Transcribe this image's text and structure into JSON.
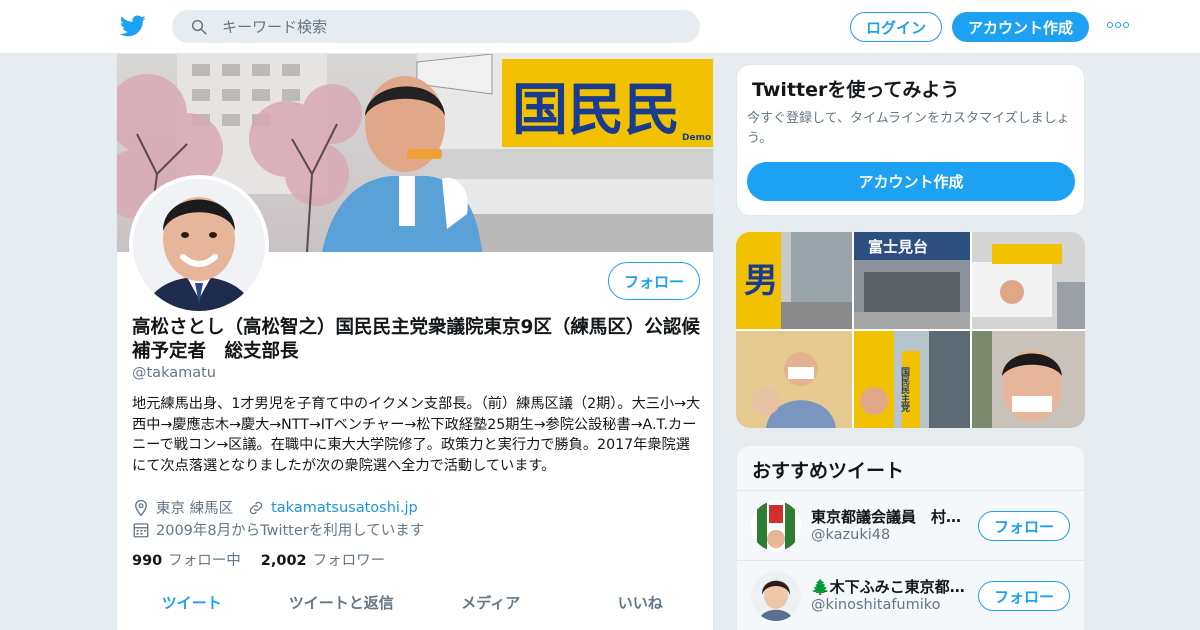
{
  "header": {
    "search_placeholder": "キーワード検索",
    "login_label": "ログイン",
    "signup_label": "アカウント作成",
    "brand_color": "#1da1f2"
  },
  "profile": {
    "name": "高松さとし（高松智之）国民民主党衆議院東京9区（練馬区）公認候補予定者　総支部長",
    "handle": "@takamatu",
    "bio": "地元練馬出身、1才男児を子育て中のイクメン支部長。（前）練馬区議（2期）。大三小→大西中→慶應志木→慶大→NTT→ITベンチャー→松下政経塾25期生→参院公設秘書→A.T.カーニーで戦コン→区議。在職中に東大大学院修了。政策力と実行力で勝負。2017年衆院選にて次点落選となりましたが次の衆院選へ全力で活動しています。",
    "location": "東京 練馬区",
    "website": "takamatsusatoshi.jp",
    "joined": "2009年8月からTwitterを利用しています",
    "following_count": "990",
    "following_label": "フォロー中",
    "followers_count": "2,002",
    "followers_label": "フォロワー",
    "follow_label": "フォロー",
    "banner_sign_text": "国民民",
    "banner_sign_sub": "Demo"
  },
  "tabs": [
    "ツイート",
    "ツイートと返信",
    "メディア",
    "いいね"
  ],
  "signup_card": {
    "title": "Twitterを使ってみよう",
    "description": "今すぐ登録して、タイムラインをカスタマイズしましょう。",
    "button_label": "アカウント作成"
  },
  "media_grid": {
    "sign_texts": [
      "男",
      "富士見台",
      "国民民主党"
    ]
  },
  "recommended": {
    "title": "おすすめツイート",
    "items": [
      {
        "name": "東京都議会議員　村上ひでこ",
        "handle": "@kazuki48",
        "follow_label": "フォロー"
      },
      {
        "name": "🌲木下ふみこ東京都議会議員",
        "handle": "@kinoshitafumiko",
        "follow_label": "フォロー"
      }
    ]
  }
}
